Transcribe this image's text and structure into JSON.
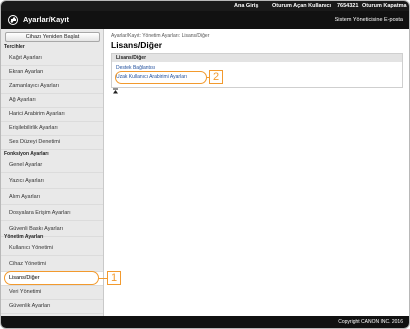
{
  "topbar": {
    "home_btn": "Ana Giriş",
    "logged_in_user": "Oturum Açan Kullanıcı",
    "user_id": "7654321",
    "logout": "Oturum Kapatma"
  },
  "header": {
    "title": "Ayarlar/Kayıt",
    "system_admin_email": "Sistem Yöneticisine E-posta"
  },
  "sidebar": {
    "restart_button": "Cihazı Yeniden Başlat",
    "sections": [
      {
        "header": "Tercihler",
        "items": [
          "Kağıt Ayarları",
          "Ekran Ayarları",
          "Zamanlayıcı Ayarları",
          "Ağ Ayarları",
          "Harici Arabirim Ayarları",
          "Erişilebilirlik Ayarları",
          "Ses Düzeyi Denetimi"
        ]
      },
      {
        "header": "Fonksiyon Ayarları",
        "items": [
          "Genel Ayarlar",
          "Yazıcı Ayarları",
          "Alım Ayarları",
          "Dosyalara Erişim Ayarları",
          "Güvenli Baskı Ayarları"
        ]
      },
      {
        "header": "Yönetim Ayarları",
        "items": [
          "Kullanıcı Yönetimi",
          "Cihaz Yönetimi",
          "Lisans/Diğer",
          "Veri Yönetimi",
          "Güvenlik Ayarları"
        ]
      }
    ]
  },
  "main": {
    "breadcrumb": "Ayarlar/Kayıt: Yönetim Ayarları: Lisans/Diğer",
    "page_title": "Lisans/Diğer",
    "section_title": "Lisans/Diğer",
    "links": [
      "Destek Bağlantısı",
      "Uzak Kullanıcı Arabirimi Ayarları"
    ]
  },
  "footer": {
    "copyright": "Copyright CANON INC. 2016"
  },
  "callouts": [
    "1",
    "2"
  ],
  "colors": {
    "callout": "#f29a2e",
    "link": "#1f4e9c",
    "topbar": "#111111"
  },
  "icons": {
    "header_logo": "settings-logo-icon",
    "scroll_top": "scroll-top-icon"
  }
}
